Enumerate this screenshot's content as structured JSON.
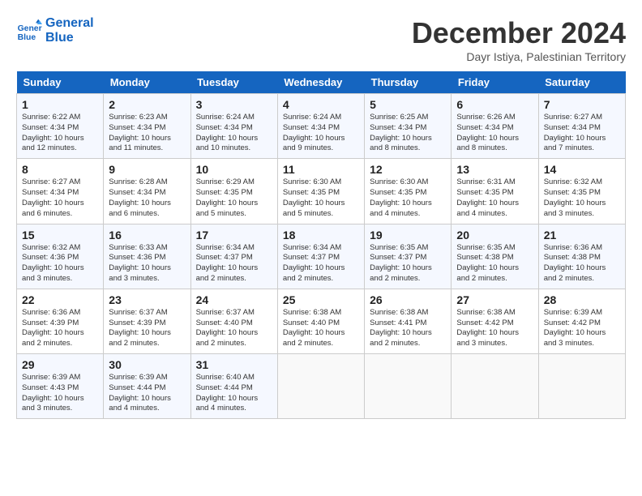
{
  "header": {
    "logo_line1": "General",
    "logo_line2": "Blue",
    "month": "December 2024",
    "location": "Dayr Istiya, Palestinian Territory"
  },
  "days_of_week": [
    "Sunday",
    "Monday",
    "Tuesday",
    "Wednesday",
    "Thursday",
    "Friday",
    "Saturday"
  ],
  "weeks": [
    [
      {
        "day": "1",
        "sunrise": "6:22 AM",
        "sunset": "4:34 PM",
        "daylight": "10 hours and 12 minutes."
      },
      {
        "day": "2",
        "sunrise": "6:23 AM",
        "sunset": "4:34 PM",
        "daylight": "10 hours and 11 minutes."
      },
      {
        "day": "3",
        "sunrise": "6:24 AM",
        "sunset": "4:34 PM",
        "daylight": "10 hours and 10 minutes."
      },
      {
        "day": "4",
        "sunrise": "6:24 AM",
        "sunset": "4:34 PM",
        "daylight": "10 hours and 9 minutes."
      },
      {
        "day": "5",
        "sunrise": "6:25 AM",
        "sunset": "4:34 PM",
        "daylight": "10 hours and 8 minutes."
      },
      {
        "day": "6",
        "sunrise": "6:26 AM",
        "sunset": "4:34 PM",
        "daylight": "10 hours and 8 minutes."
      },
      {
        "day": "7",
        "sunrise": "6:27 AM",
        "sunset": "4:34 PM",
        "daylight": "10 hours and 7 minutes."
      }
    ],
    [
      {
        "day": "8",
        "sunrise": "6:27 AM",
        "sunset": "4:34 PM",
        "daylight": "10 hours and 6 minutes."
      },
      {
        "day": "9",
        "sunrise": "6:28 AM",
        "sunset": "4:34 PM",
        "daylight": "10 hours and 6 minutes."
      },
      {
        "day": "10",
        "sunrise": "6:29 AM",
        "sunset": "4:35 PM",
        "daylight": "10 hours and 5 minutes."
      },
      {
        "day": "11",
        "sunrise": "6:30 AM",
        "sunset": "4:35 PM",
        "daylight": "10 hours and 5 minutes."
      },
      {
        "day": "12",
        "sunrise": "6:30 AM",
        "sunset": "4:35 PM",
        "daylight": "10 hours and 4 minutes."
      },
      {
        "day": "13",
        "sunrise": "6:31 AM",
        "sunset": "4:35 PM",
        "daylight": "10 hours and 4 minutes."
      },
      {
        "day": "14",
        "sunrise": "6:32 AM",
        "sunset": "4:35 PM",
        "daylight": "10 hours and 3 minutes."
      }
    ],
    [
      {
        "day": "15",
        "sunrise": "6:32 AM",
        "sunset": "4:36 PM",
        "daylight": "10 hours and 3 minutes."
      },
      {
        "day": "16",
        "sunrise": "6:33 AM",
        "sunset": "4:36 PM",
        "daylight": "10 hours and 3 minutes."
      },
      {
        "day": "17",
        "sunrise": "6:34 AM",
        "sunset": "4:37 PM",
        "daylight": "10 hours and 2 minutes."
      },
      {
        "day": "18",
        "sunrise": "6:34 AM",
        "sunset": "4:37 PM",
        "daylight": "10 hours and 2 minutes."
      },
      {
        "day": "19",
        "sunrise": "6:35 AM",
        "sunset": "4:37 PM",
        "daylight": "10 hours and 2 minutes."
      },
      {
        "day": "20",
        "sunrise": "6:35 AM",
        "sunset": "4:38 PM",
        "daylight": "10 hours and 2 minutes."
      },
      {
        "day": "21",
        "sunrise": "6:36 AM",
        "sunset": "4:38 PM",
        "daylight": "10 hours and 2 minutes."
      }
    ],
    [
      {
        "day": "22",
        "sunrise": "6:36 AM",
        "sunset": "4:39 PM",
        "daylight": "10 hours and 2 minutes."
      },
      {
        "day": "23",
        "sunrise": "6:37 AM",
        "sunset": "4:39 PM",
        "daylight": "10 hours and 2 minutes."
      },
      {
        "day": "24",
        "sunrise": "6:37 AM",
        "sunset": "4:40 PM",
        "daylight": "10 hours and 2 minutes."
      },
      {
        "day": "25",
        "sunrise": "6:38 AM",
        "sunset": "4:40 PM",
        "daylight": "10 hours and 2 minutes."
      },
      {
        "day": "26",
        "sunrise": "6:38 AM",
        "sunset": "4:41 PM",
        "daylight": "10 hours and 2 minutes."
      },
      {
        "day": "27",
        "sunrise": "6:38 AM",
        "sunset": "4:42 PM",
        "daylight": "10 hours and 3 minutes."
      },
      {
        "day": "28",
        "sunrise": "6:39 AM",
        "sunset": "4:42 PM",
        "daylight": "10 hours and 3 minutes."
      }
    ],
    [
      {
        "day": "29",
        "sunrise": "6:39 AM",
        "sunset": "4:43 PM",
        "daylight": "10 hours and 3 minutes."
      },
      {
        "day": "30",
        "sunrise": "6:39 AM",
        "sunset": "4:44 PM",
        "daylight": "10 hours and 4 minutes."
      },
      {
        "day": "31",
        "sunrise": "6:40 AM",
        "sunset": "4:44 PM",
        "daylight": "10 hours and 4 minutes."
      },
      null,
      null,
      null,
      null
    ]
  ]
}
